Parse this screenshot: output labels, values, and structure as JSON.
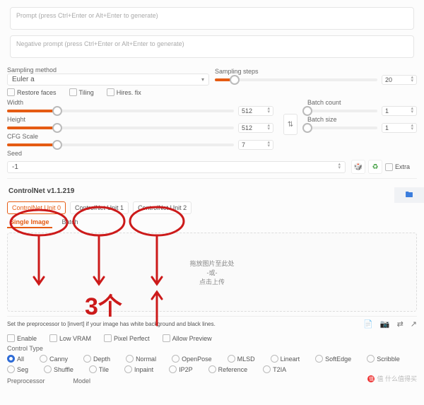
{
  "prompt": {
    "placeholder": "Prompt (press Ctrl+Enter or Alt+Enter to generate)"
  },
  "neg_prompt": {
    "placeholder": "Negative prompt (press Ctrl+Enter or Alt+Enter to generate)"
  },
  "sampling_method": {
    "label": "Sampling method",
    "value": "Euler a"
  },
  "sampling_steps": {
    "label": "Sampling steps",
    "value": "20",
    "fill_pct": 12
  },
  "restore_faces": "Restore faces",
  "tiling": "Tiling",
  "hires_fix": "Hires. fix",
  "width": {
    "label": "Width",
    "value": "512",
    "fill_pct": 22
  },
  "height": {
    "label": "Height",
    "value": "512",
    "fill_pct": 22
  },
  "cfg": {
    "label": "CFG Scale",
    "value": "7",
    "fill_pct": 22
  },
  "batch_count": {
    "label": "Batch count",
    "value": "1",
    "fill_pct": 0
  },
  "batch_size": {
    "label": "Batch size",
    "value": "1",
    "fill_pct": 0
  },
  "seed": {
    "label": "Seed",
    "value": "-1",
    "dice": "🎲",
    "recycle": "♻",
    "extra": "Extra"
  },
  "controlnet": {
    "title": "ControlNet v1.1.219",
    "tabs": [
      "ControlNet Unit 0",
      "ControlNet Unit 1",
      "ControlNet Unit 2"
    ],
    "subtabs": [
      "Single Image",
      "Batch"
    ],
    "dropzone": {
      "line1": "拖放图片至此处",
      "line2": "-或-",
      "line3": "点击上传"
    },
    "hint": "Set the preprocessor to [invert] if your image has white background and black lines.",
    "enable": "Enable",
    "low_vram": "Low VRAM",
    "pixel_perfect": "Pixel Perfect",
    "allow_preview": "Allow Preview",
    "control_type_label": "Control Type",
    "types": [
      "All",
      "Canny",
      "Depth",
      "Normal",
      "OpenPose",
      "MLSD",
      "Lineart",
      "SoftEdge",
      "Scribble",
      "Seg",
      "Shuffle",
      "Tile",
      "Inpaint",
      "IP2P",
      "Reference",
      "T2IA"
    ],
    "preprocessor_label": "Preprocessor",
    "model_label": "Model"
  },
  "annotation_text": "3个",
  "watermark": "值 什么值得买"
}
